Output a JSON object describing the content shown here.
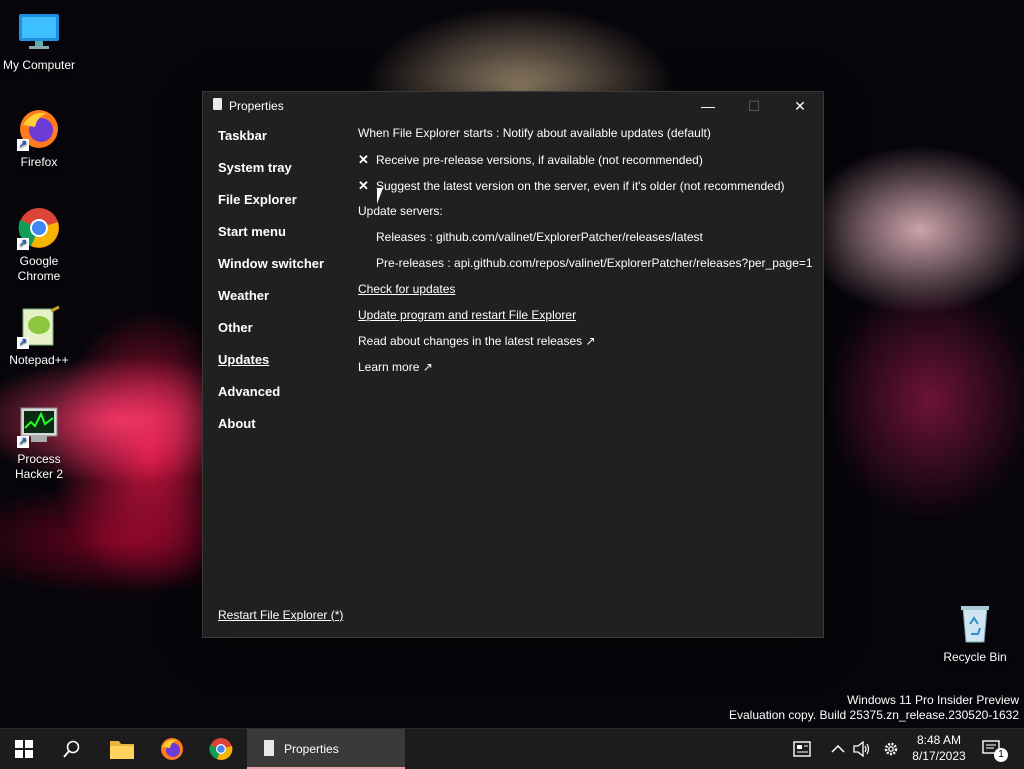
{
  "desktop": {
    "icons": [
      {
        "label": "My Computer"
      },
      {
        "label": "Firefox"
      },
      {
        "label": "Google Chrome"
      },
      {
        "label": "Notepad++"
      },
      {
        "label": "Process Hacker 2"
      },
      {
        "label": "Recycle Bin"
      }
    ],
    "watermark": {
      "line1": "Windows 11 Pro Insider Preview",
      "line2": "Evaluation copy. Build 25375.zn_release.230520-1632"
    }
  },
  "window": {
    "title": "Properties",
    "nav": [
      {
        "label": "Taskbar"
      },
      {
        "label": "System tray"
      },
      {
        "label": "File Explorer"
      },
      {
        "label": "Start menu"
      },
      {
        "label": "Window switcher"
      },
      {
        "label": "Weather"
      },
      {
        "label": "Other"
      },
      {
        "label": "Updates",
        "active": true
      },
      {
        "label": "Advanced"
      },
      {
        "label": "About"
      }
    ],
    "content": {
      "explorer_start": "When File Explorer starts : Notify about available updates (default)",
      "prerelease": "Receive pre-release versions, if available (not recommended)",
      "suggest_latest": "Suggest the latest version on the server, even if it's older (not recommended)",
      "check_mark": "✕",
      "update_servers": "Update servers:",
      "releases": "Releases : github.com/valinet/ExplorerPatcher/releases/latest",
      "prereleases": "Pre-releases : api.github.com/repos/valinet/ExplorerPatcher/releases?per_page=1",
      "check_updates": "Check for updates",
      "update_restart": "Update program and restart File Explorer",
      "read_changes": "Read about changes in the latest releases ↗",
      "learn_more": "Learn more ↗"
    },
    "restart_link": "Restart File Explorer (*)",
    "caption": {
      "minimize": "—",
      "maximize": "☐",
      "close": "✕"
    }
  },
  "taskbar": {
    "properties_label": "Properties",
    "clock_time": "8:48 AM",
    "clock_date": "8/17/2023",
    "notification_count": "1"
  }
}
